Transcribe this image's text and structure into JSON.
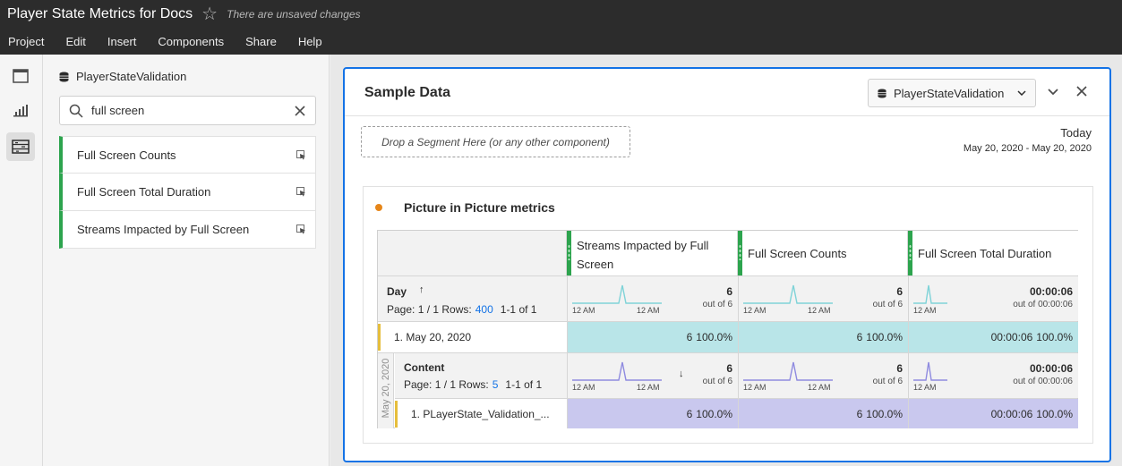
{
  "titlebar": {
    "title": "Player State Metrics for Docs",
    "unsaved": "There are unsaved changes"
  },
  "menu": [
    "Project",
    "Edit",
    "Insert",
    "Components",
    "Share",
    "Help"
  ],
  "panel": {
    "suite": "PlayerStateValidation",
    "search_value": "full screen",
    "items": [
      "Full Screen Counts",
      "Full Screen Total Duration",
      "Streams Impacted by Full Screen"
    ]
  },
  "project": {
    "title": "Sample Data",
    "suite": "PlayerStateValidation",
    "dropzone": "Drop a Segment Here (or any other component)",
    "date_label": "Today",
    "date_value": "May 20, 2020 - May 20, 2020"
  },
  "freeform": {
    "title": "Picture in Picture metrics",
    "columns": [
      "Streams Impacted by Full Screen",
      "Full Screen Counts",
      "Full Screen Total Duration"
    ],
    "day": {
      "title": "Day",
      "page": "Page: 1 / 1",
      "rows_label": "Rows:",
      "rows_value": "400",
      "range": "1-1 of 1",
      "summaries": [
        {
          "value": "6",
          "sub": "out of 6"
        },
        {
          "value": "6",
          "sub": "out of 6"
        },
        {
          "value": "00:00:06",
          "sub": "out of 00:00:06"
        }
      ],
      "row": {
        "label": "1.  May 20, 2020",
        "cells": [
          {
            "value": "6",
            "pct": "100.0%"
          },
          {
            "value": "6",
            "pct": "100.0%"
          },
          {
            "value": "00:00:06",
            "pct": "100.0%"
          }
        ]
      }
    },
    "breakdown_label": "May 20, 2020",
    "content": {
      "title": "Content",
      "page": "Page: 1 / 1",
      "rows_label": "Rows:",
      "rows_value": "5",
      "range": "1-1 of 1",
      "summaries": [
        {
          "value": "6",
          "sub": "out of 6"
        },
        {
          "value": "6",
          "sub": "out of 6"
        },
        {
          "value": "00:00:06",
          "sub": "out of 00:00:06"
        }
      ],
      "row": {
        "label": "1.  PLayerState_Validation_...",
        "cells": [
          {
            "value": "6",
            "pct": "100.0%"
          },
          {
            "value": "6",
            "pct": "100.0%"
          },
          {
            "value": "00:00:06",
            "pct": "100.0%"
          }
        ]
      }
    },
    "spark_labels": {
      "start": "12 AM",
      "end": "12 AM"
    }
  },
  "colors": {
    "accent": "#1473e6",
    "green": "#2da44e",
    "teal": "#b9e5e8",
    "purple": "#c9c8ee",
    "sparkTeal": "#7fd3d8",
    "sparkPurple": "#8f8be0",
    "orange": "#e68619"
  }
}
